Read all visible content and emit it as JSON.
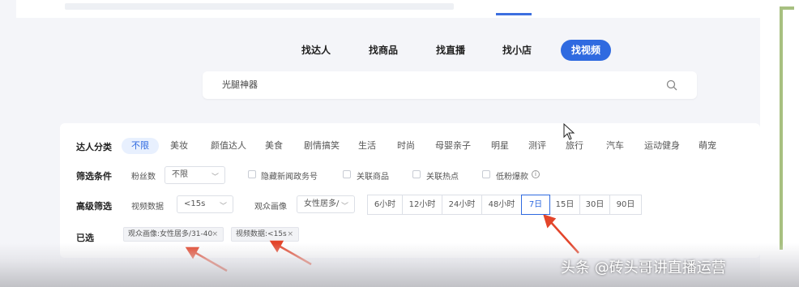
{
  "nav_tabs": [
    {
      "label": "找达人"
    },
    {
      "label": "找商品"
    },
    {
      "label": "找直播"
    },
    {
      "label": "找小店"
    },
    {
      "label": "找视频",
      "active": true
    }
  ],
  "search": {
    "value": "光腿神器"
  },
  "categories": {
    "label": "达人分类",
    "items": [
      "不限",
      "美妆",
      "颜值达人",
      "美食",
      "剧情搞笑",
      "生活",
      "时尚",
      "母婴亲子",
      "明星",
      "测评",
      "旅行",
      "汽车",
      "运动健身",
      "萌宠"
    ]
  },
  "filters": {
    "label": "筛选条件",
    "fans_label": "粉丝数",
    "fans_value": "不限",
    "checkboxes": [
      "隐藏新闻政务号",
      "关联商品",
      "关联热点",
      "低粉爆款"
    ]
  },
  "advanced": {
    "label": "高级筛选",
    "video_label": "视频数据",
    "video_value": "<15s",
    "audience_label": "观众画像",
    "audience_value": "女性居多/",
    "time_ranges": [
      "6小时",
      "12小时",
      "24小时",
      "48小时",
      "7日",
      "15日",
      "30日",
      "90日"
    ],
    "active_time": "7日"
  },
  "selected": {
    "label": "已选",
    "tags": [
      "观众画像:女性居多/31-40",
      "视频数据:<15s"
    ]
  },
  "watermark": "头条 @砖头哥讲直播运营",
  "colors": {
    "accent": "#2f6ae0",
    "arrow": "#e3452b"
  }
}
